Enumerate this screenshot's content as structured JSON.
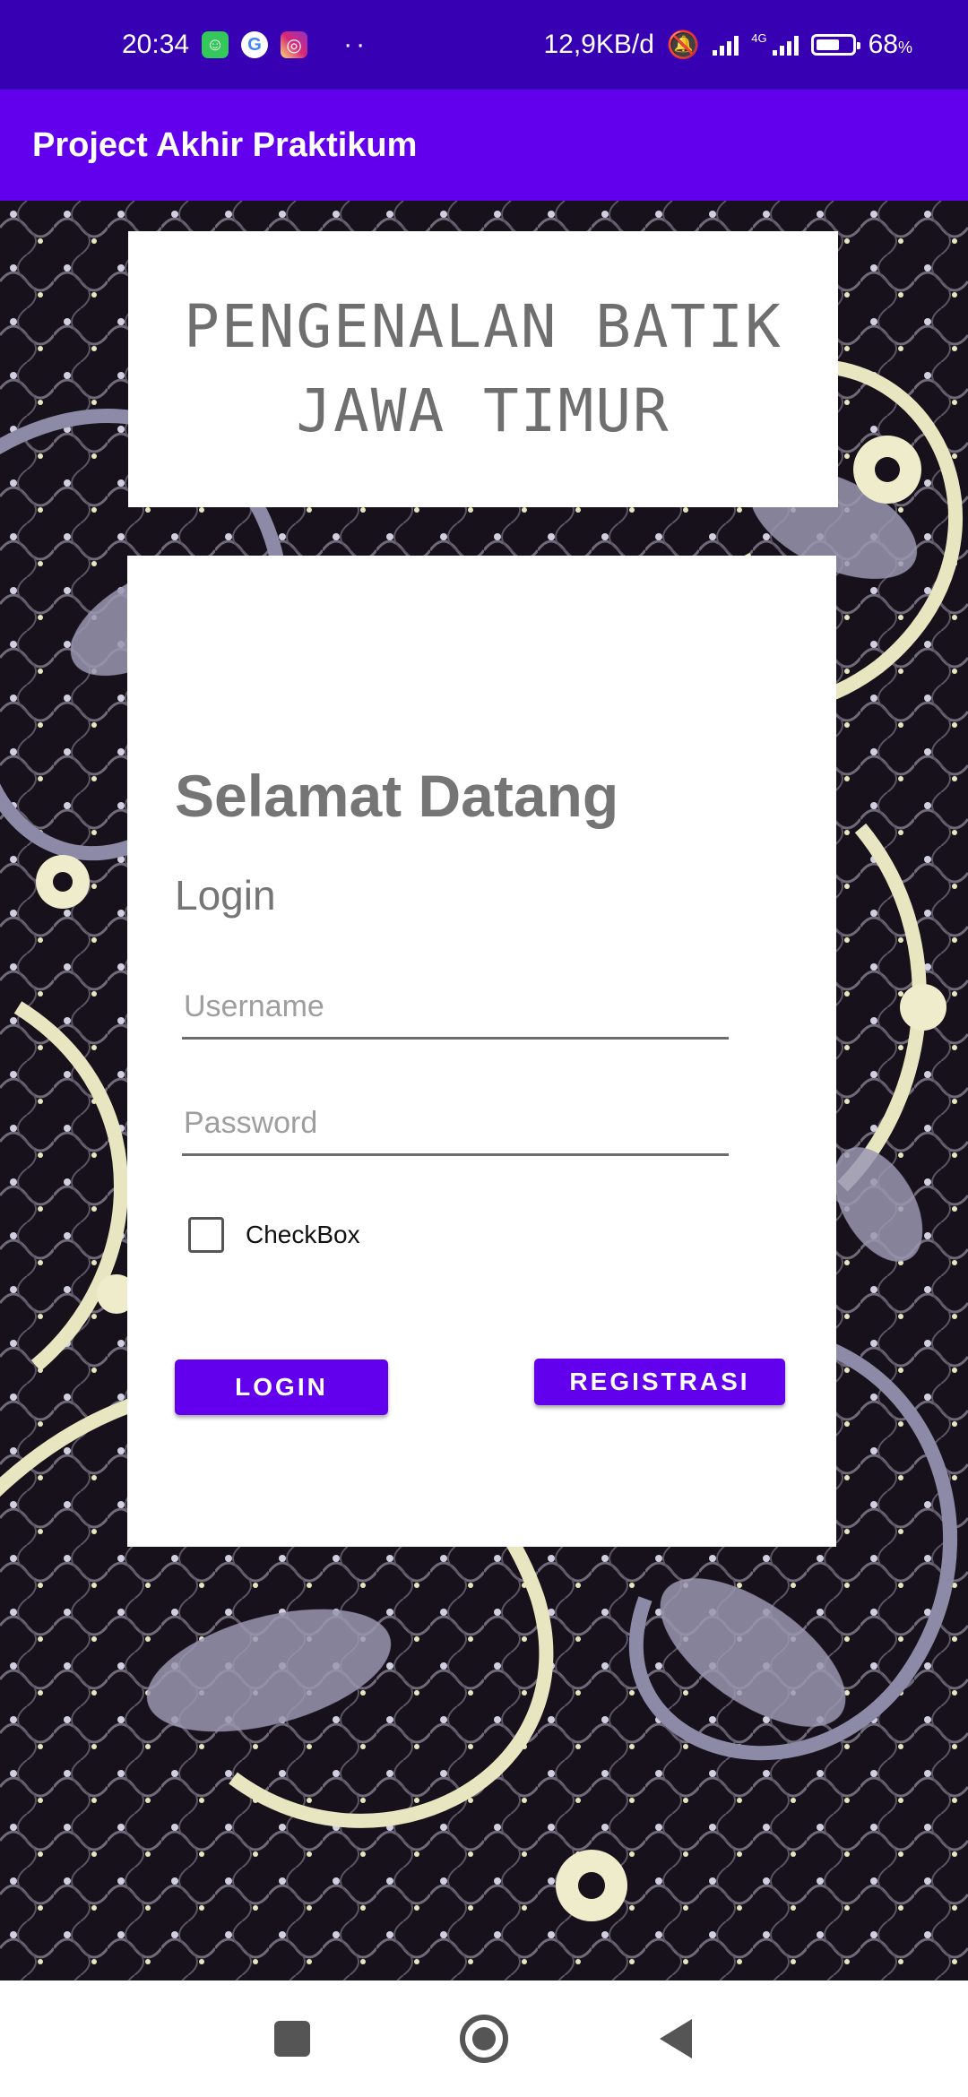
{
  "status_bar": {
    "time": "20:34",
    "speed": "12,9KB/d",
    "network_tag": "4G",
    "battery_pct": "68",
    "battery_unit": "%",
    "battery_level": 0.68,
    "notif_icons": [
      "messenger-app-icon",
      "google-icon",
      "instagram-icon"
    ]
  },
  "app_bar": {
    "title": "Project Akhir Praktikum"
  },
  "title_card": {
    "line1": "PENGENALAN BATIK",
    "line2": "JAWA TIMUR"
  },
  "login": {
    "welcome": "Selamat Datang",
    "subtitle": "Login",
    "username_placeholder": "Username",
    "password_placeholder": "Password",
    "checkbox_label": "CheckBox",
    "checkbox_checked": false,
    "login_button": "LOGIN",
    "register_button": "REGISTRASI"
  },
  "colors": {
    "status_bar": "#3700b3",
    "primary": "#6200ee",
    "text_gray": "#757575"
  }
}
